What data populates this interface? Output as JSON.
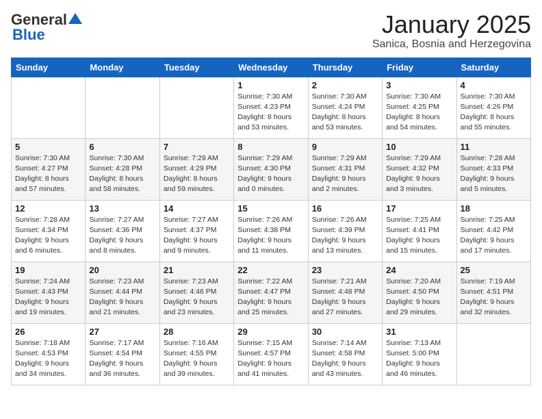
{
  "header": {
    "logo_general": "General",
    "logo_blue": "Blue",
    "month_title": "January 2025",
    "location": "Sanica, Bosnia and Herzegovina"
  },
  "weekdays": [
    "Sunday",
    "Monday",
    "Tuesday",
    "Wednesday",
    "Thursday",
    "Friday",
    "Saturday"
  ],
  "weeks": [
    [
      {
        "day": "",
        "info": ""
      },
      {
        "day": "",
        "info": ""
      },
      {
        "day": "",
        "info": ""
      },
      {
        "day": "1",
        "info": "Sunrise: 7:30 AM\nSunset: 4:23 PM\nDaylight: 8 hours and 53 minutes."
      },
      {
        "day": "2",
        "info": "Sunrise: 7:30 AM\nSunset: 4:24 PM\nDaylight: 8 hours and 53 minutes."
      },
      {
        "day": "3",
        "info": "Sunrise: 7:30 AM\nSunset: 4:25 PM\nDaylight: 8 hours and 54 minutes."
      },
      {
        "day": "4",
        "info": "Sunrise: 7:30 AM\nSunset: 4:26 PM\nDaylight: 8 hours and 55 minutes."
      }
    ],
    [
      {
        "day": "5",
        "info": "Sunrise: 7:30 AM\nSunset: 4:27 PM\nDaylight: 8 hours and 57 minutes."
      },
      {
        "day": "6",
        "info": "Sunrise: 7:30 AM\nSunset: 4:28 PM\nDaylight: 8 hours and 58 minutes."
      },
      {
        "day": "7",
        "info": "Sunrise: 7:29 AM\nSunset: 4:29 PM\nDaylight: 8 hours and 59 minutes."
      },
      {
        "day": "8",
        "info": "Sunrise: 7:29 AM\nSunset: 4:30 PM\nDaylight: 9 hours and 0 minutes."
      },
      {
        "day": "9",
        "info": "Sunrise: 7:29 AM\nSunset: 4:31 PM\nDaylight: 9 hours and 2 minutes."
      },
      {
        "day": "10",
        "info": "Sunrise: 7:29 AM\nSunset: 4:32 PM\nDaylight: 9 hours and 3 minutes."
      },
      {
        "day": "11",
        "info": "Sunrise: 7:28 AM\nSunset: 4:33 PM\nDaylight: 9 hours and 5 minutes."
      }
    ],
    [
      {
        "day": "12",
        "info": "Sunrise: 7:28 AM\nSunset: 4:34 PM\nDaylight: 9 hours and 6 minutes."
      },
      {
        "day": "13",
        "info": "Sunrise: 7:27 AM\nSunset: 4:36 PM\nDaylight: 9 hours and 8 minutes."
      },
      {
        "day": "14",
        "info": "Sunrise: 7:27 AM\nSunset: 4:37 PM\nDaylight: 9 hours and 9 minutes."
      },
      {
        "day": "15",
        "info": "Sunrise: 7:26 AM\nSunset: 4:38 PM\nDaylight: 9 hours and 11 minutes."
      },
      {
        "day": "16",
        "info": "Sunrise: 7:26 AM\nSunset: 4:39 PM\nDaylight: 9 hours and 13 minutes."
      },
      {
        "day": "17",
        "info": "Sunrise: 7:25 AM\nSunset: 4:41 PM\nDaylight: 9 hours and 15 minutes."
      },
      {
        "day": "18",
        "info": "Sunrise: 7:25 AM\nSunset: 4:42 PM\nDaylight: 9 hours and 17 minutes."
      }
    ],
    [
      {
        "day": "19",
        "info": "Sunrise: 7:24 AM\nSunset: 4:43 PM\nDaylight: 9 hours and 19 minutes."
      },
      {
        "day": "20",
        "info": "Sunrise: 7:23 AM\nSunset: 4:44 PM\nDaylight: 9 hours and 21 minutes."
      },
      {
        "day": "21",
        "info": "Sunrise: 7:23 AM\nSunset: 4:46 PM\nDaylight: 9 hours and 23 minutes."
      },
      {
        "day": "22",
        "info": "Sunrise: 7:22 AM\nSunset: 4:47 PM\nDaylight: 9 hours and 25 minutes."
      },
      {
        "day": "23",
        "info": "Sunrise: 7:21 AM\nSunset: 4:48 PM\nDaylight: 9 hours and 27 minutes."
      },
      {
        "day": "24",
        "info": "Sunrise: 7:20 AM\nSunset: 4:50 PM\nDaylight: 9 hours and 29 minutes."
      },
      {
        "day": "25",
        "info": "Sunrise: 7:19 AM\nSunset: 4:51 PM\nDaylight: 9 hours and 32 minutes."
      }
    ],
    [
      {
        "day": "26",
        "info": "Sunrise: 7:18 AM\nSunset: 4:53 PM\nDaylight: 9 hours and 34 minutes."
      },
      {
        "day": "27",
        "info": "Sunrise: 7:17 AM\nSunset: 4:54 PM\nDaylight: 9 hours and 36 minutes."
      },
      {
        "day": "28",
        "info": "Sunrise: 7:16 AM\nSunset: 4:55 PM\nDaylight: 9 hours and 39 minutes."
      },
      {
        "day": "29",
        "info": "Sunrise: 7:15 AM\nSunset: 4:57 PM\nDaylight: 9 hours and 41 minutes."
      },
      {
        "day": "30",
        "info": "Sunrise: 7:14 AM\nSunset: 4:58 PM\nDaylight: 9 hours and 43 minutes."
      },
      {
        "day": "31",
        "info": "Sunrise: 7:13 AM\nSunset: 5:00 PM\nDaylight: 9 hours and 46 minutes."
      },
      {
        "day": "",
        "info": ""
      }
    ]
  ]
}
